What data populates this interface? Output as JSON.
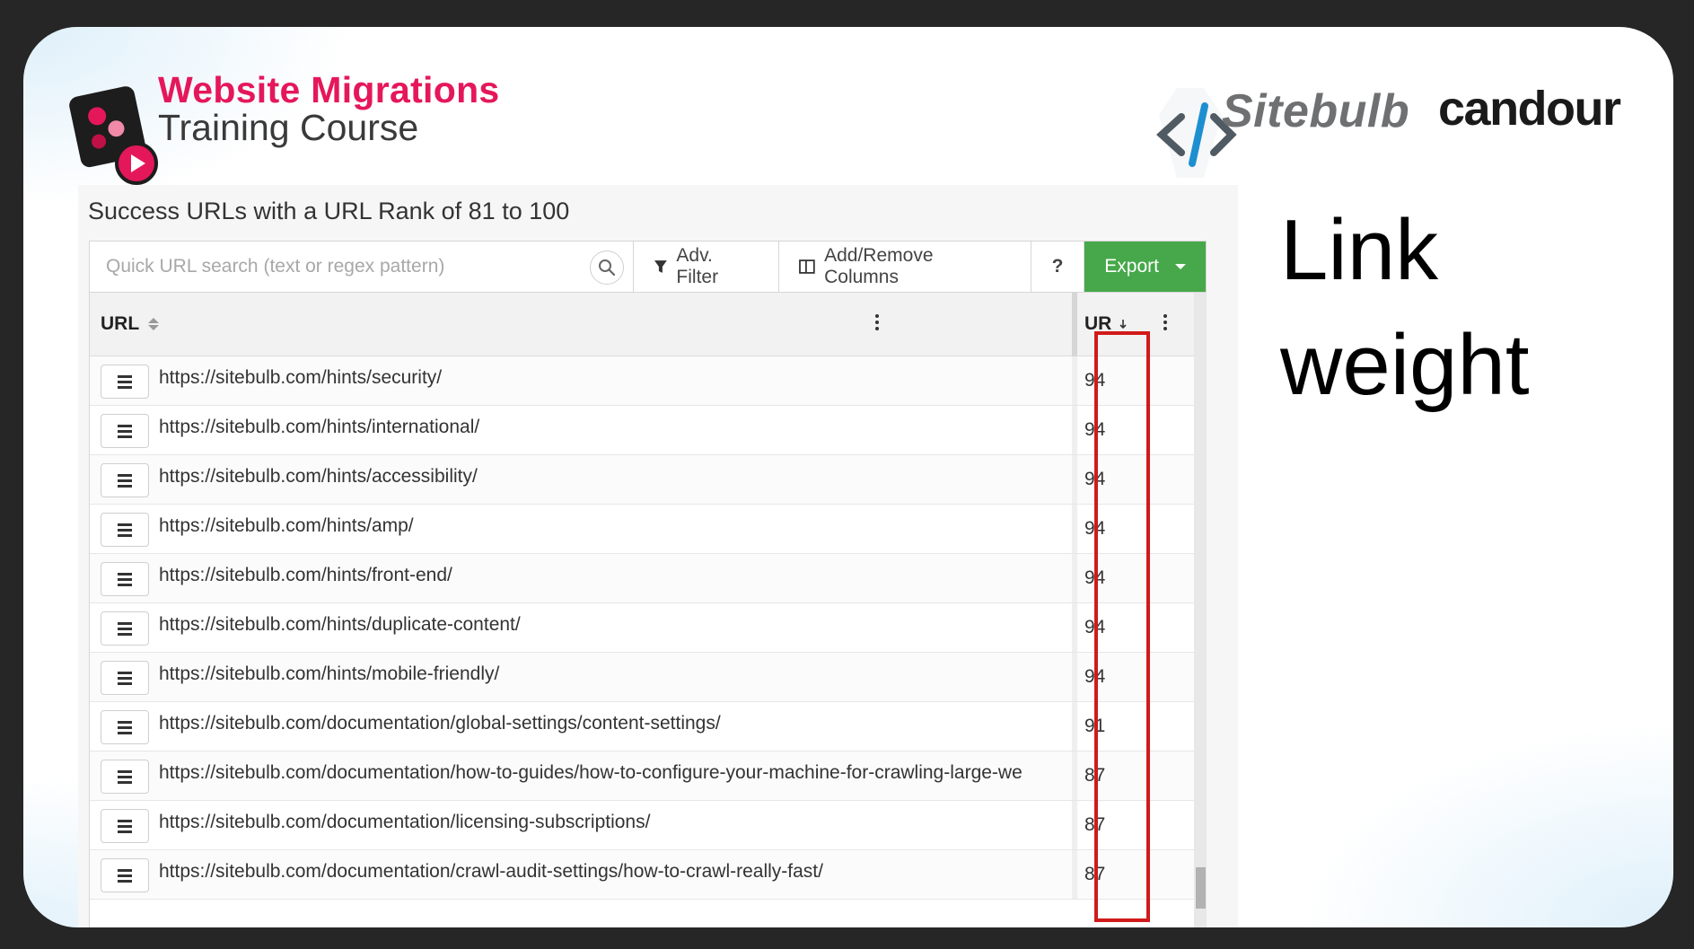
{
  "branding": {
    "course_title_line1": "Website Migrations",
    "course_title_line2": "Training Course",
    "sitebulb": "Sitebulb",
    "candour": "candour"
  },
  "slide": {
    "side_title": "Link weight"
  },
  "panel": {
    "title": "Success URLs with a URL Rank of 81 to 100",
    "search_placeholder": "Quick URL search (text or regex pattern)",
    "adv_filter_label": "Adv. Filter",
    "columns_label": "Add/Remove Columns",
    "help_label": "?",
    "export_label": "Export"
  },
  "table": {
    "col_url": "URL",
    "col_ur": "UR",
    "rows": [
      {
        "url": "https://sitebulb.com/hints/security/",
        "ur": "94"
      },
      {
        "url": "https://sitebulb.com/hints/international/",
        "ur": "94"
      },
      {
        "url": "https://sitebulb.com/hints/accessibility/",
        "ur": "94"
      },
      {
        "url": "https://sitebulb.com/hints/amp/",
        "ur": "94"
      },
      {
        "url": "https://sitebulb.com/hints/front-end/",
        "ur": "94"
      },
      {
        "url": "https://sitebulb.com/hints/duplicate-content/",
        "ur": "94"
      },
      {
        "url": "https://sitebulb.com/hints/mobile-friendly/",
        "ur": "94"
      },
      {
        "url": "https://sitebulb.com/documentation/global-settings/content-settings/",
        "ur": "91"
      },
      {
        "url": "https://sitebulb.com/documentation/how-to-guides/how-to-configure-your-machine-for-crawling-large-we",
        "ur": "87"
      },
      {
        "url": "https://sitebulb.com/documentation/licensing-subscriptions/",
        "ur": "87"
      },
      {
        "url": "https://sitebulb.com/documentation/crawl-audit-settings/how-to-crawl-really-fast/",
        "ur": "87"
      }
    ]
  },
  "colors": {
    "brand_pink": "#e5175b",
    "export_green": "#46a84a",
    "highlight_red": "#d11a1a"
  }
}
